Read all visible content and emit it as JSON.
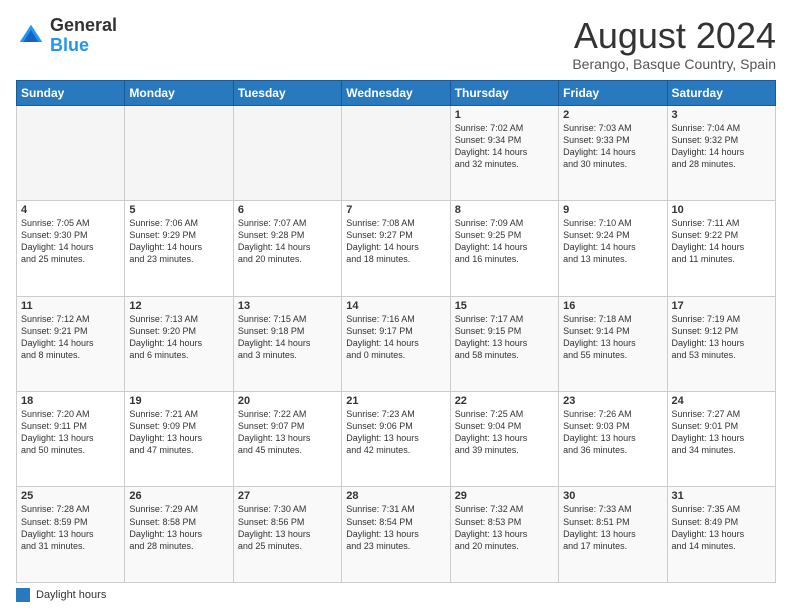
{
  "logo": {
    "general": "General",
    "blue": "Blue"
  },
  "title": "August 2024",
  "subtitle": "Berango, Basque Country, Spain",
  "days_of_week": [
    "Sunday",
    "Monday",
    "Tuesday",
    "Wednesday",
    "Thursday",
    "Friday",
    "Saturday"
  ],
  "legend_label": "Daylight hours",
  "weeks": [
    [
      {
        "day": "",
        "info": ""
      },
      {
        "day": "",
        "info": ""
      },
      {
        "day": "",
        "info": ""
      },
      {
        "day": "",
        "info": ""
      },
      {
        "day": "1",
        "info": "Sunrise: 7:02 AM\nSunset: 9:34 PM\nDaylight: 14 hours\nand 32 minutes."
      },
      {
        "day": "2",
        "info": "Sunrise: 7:03 AM\nSunset: 9:33 PM\nDaylight: 14 hours\nand 30 minutes."
      },
      {
        "day": "3",
        "info": "Sunrise: 7:04 AM\nSunset: 9:32 PM\nDaylight: 14 hours\nand 28 minutes."
      }
    ],
    [
      {
        "day": "4",
        "info": "Sunrise: 7:05 AM\nSunset: 9:30 PM\nDaylight: 14 hours\nand 25 minutes."
      },
      {
        "day": "5",
        "info": "Sunrise: 7:06 AM\nSunset: 9:29 PM\nDaylight: 14 hours\nand 23 minutes."
      },
      {
        "day": "6",
        "info": "Sunrise: 7:07 AM\nSunset: 9:28 PM\nDaylight: 14 hours\nand 20 minutes."
      },
      {
        "day": "7",
        "info": "Sunrise: 7:08 AM\nSunset: 9:27 PM\nDaylight: 14 hours\nand 18 minutes."
      },
      {
        "day": "8",
        "info": "Sunrise: 7:09 AM\nSunset: 9:25 PM\nDaylight: 14 hours\nand 16 minutes."
      },
      {
        "day": "9",
        "info": "Sunrise: 7:10 AM\nSunset: 9:24 PM\nDaylight: 14 hours\nand 13 minutes."
      },
      {
        "day": "10",
        "info": "Sunrise: 7:11 AM\nSunset: 9:22 PM\nDaylight: 14 hours\nand 11 minutes."
      }
    ],
    [
      {
        "day": "11",
        "info": "Sunrise: 7:12 AM\nSunset: 9:21 PM\nDaylight: 14 hours\nand 8 minutes."
      },
      {
        "day": "12",
        "info": "Sunrise: 7:13 AM\nSunset: 9:20 PM\nDaylight: 14 hours\nand 6 minutes."
      },
      {
        "day": "13",
        "info": "Sunrise: 7:15 AM\nSunset: 9:18 PM\nDaylight: 14 hours\nand 3 minutes."
      },
      {
        "day": "14",
        "info": "Sunrise: 7:16 AM\nSunset: 9:17 PM\nDaylight: 14 hours\nand 0 minutes."
      },
      {
        "day": "15",
        "info": "Sunrise: 7:17 AM\nSunset: 9:15 PM\nDaylight: 13 hours\nand 58 minutes."
      },
      {
        "day": "16",
        "info": "Sunrise: 7:18 AM\nSunset: 9:14 PM\nDaylight: 13 hours\nand 55 minutes."
      },
      {
        "day": "17",
        "info": "Sunrise: 7:19 AM\nSunset: 9:12 PM\nDaylight: 13 hours\nand 53 minutes."
      }
    ],
    [
      {
        "day": "18",
        "info": "Sunrise: 7:20 AM\nSunset: 9:11 PM\nDaylight: 13 hours\nand 50 minutes."
      },
      {
        "day": "19",
        "info": "Sunrise: 7:21 AM\nSunset: 9:09 PM\nDaylight: 13 hours\nand 47 minutes."
      },
      {
        "day": "20",
        "info": "Sunrise: 7:22 AM\nSunset: 9:07 PM\nDaylight: 13 hours\nand 45 minutes."
      },
      {
        "day": "21",
        "info": "Sunrise: 7:23 AM\nSunset: 9:06 PM\nDaylight: 13 hours\nand 42 minutes."
      },
      {
        "day": "22",
        "info": "Sunrise: 7:25 AM\nSunset: 9:04 PM\nDaylight: 13 hours\nand 39 minutes."
      },
      {
        "day": "23",
        "info": "Sunrise: 7:26 AM\nSunset: 9:03 PM\nDaylight: 13 hours\nand 36 minutes."
      },
      {
        "day": "24",
        "info": "Sunrise: 7:27 AM\nSunset: 9:01 PM\nDaylight: 13 hours\nand 34 minutes."
      }
    ],
    [
      {
        "day": "25",
        "info": "Sunrise: 7:28 AM\nSunset: 8:59 PM\nDaylight: 13 hours\nand 31 minutes."
      },
      {
        "day": "26",
        "info": "Sunrise: 7:29 AM\nSunset: 8:58 PM\nDaylight: 13 hours\nand 28 minutes."
      },
      {
        "day": "27",
        "info": "Sunrise: 7:30 AM\nSunset: 8:56 PM\nDaylight: 13 hours\nand 25 minutes."
      },
      {
        "day": "28",
        "info": "Sunrise: 7:31 AM\nSunset: 8:54 PM\nDaylight: 13 hours\nand 23 minutes."
      },
      {
        "day": "29",
        "info": "Sunrise: 7:32 AM\nSunset: 8:53 PM\nDaylight: 13 hours\nand 20 minutes."
      },
      {
        "day": "30",
        "info": "Sunrise: 7:33 AM\nSunset: 8:51 PM\nDaylight: 13 hours\nand 17 minutes."
      },
      {
        "day": "31",
        "info": "Sunrise: 7:35 AM\nSunset: 8:49 PM\nDaylight: 13 hours\nand 14 minutes."
      }
    ]
  ]
}
